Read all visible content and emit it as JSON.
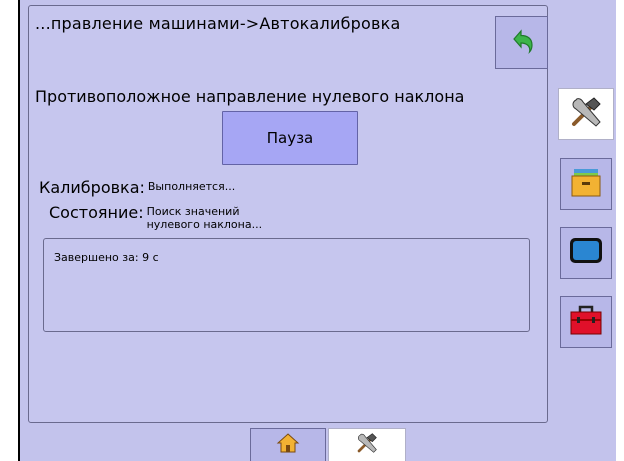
{
  "header": {
    "title": "...правление машинами->Автокалибровка",
    "back_icon": "back-arrow-icon"
  },
  "main": {
    "subtitle": "Противоположное направление нулевого наклона",
    "pause_label": "Пауза",
    "calibration": {
      "label": "Калибровка:",
      "value": "Выполняется..."
    },
    "state": {
      "label": "Состояние:",
      "value": "Поиск значений\nнулевого наклона..."
    },
    "log": {
      "text": "Завершено за: 9 с"
    }
  },
  "sidebar": {
    "items": [
      {
        "icon": "tools-icon",
        "active": true
      },
      {
        "icon": "drawer-icon",
        "active": false
      },
      {
        "icon": "monitor-icon",
        "active": false
      },
      {
        "icon": "toolbox-icon",
        "active": false
      }
    ]
  },
  "bottom_tabs": [
    {
      "icon": "home-icon",
      "active": false
    },
    {
      "icon": "tools-icon",
      "active": true
    }
  ],
  "colors": {
    "background": "#c3c3ec",
    "button": "#a6a6f4",
    "back_arrow": "#3cb44a",
    "toolbox": "#e0102a",
    "drawer": "#f2b233",
    "monitor": "#2a86d2"
  }
}
